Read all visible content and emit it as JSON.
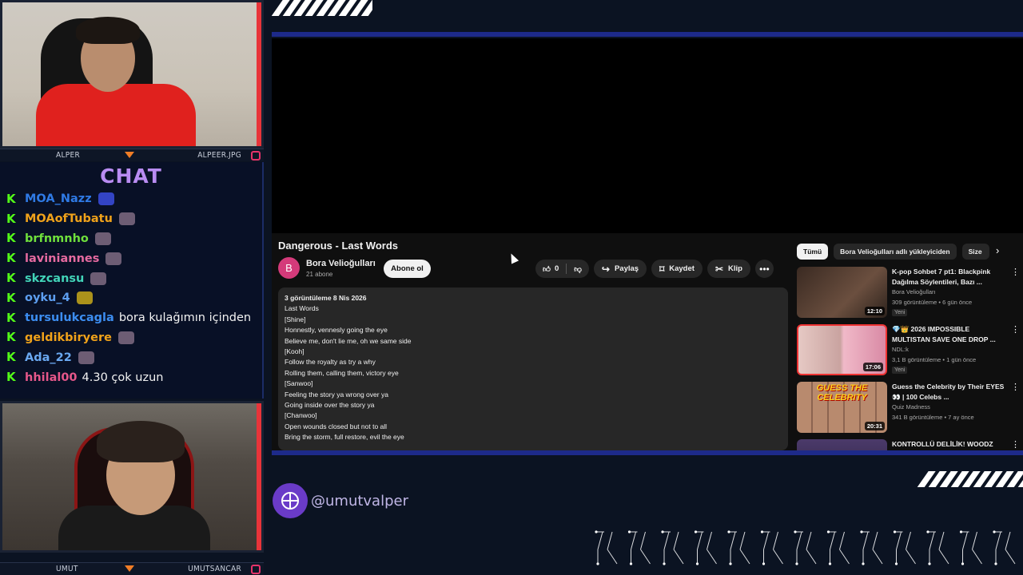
{
  "cams": {
    "top": {
      "left_name": "ALPER",
      "right_name": "ALPEER.JPG"
    },
    "bottom": {
      "left_name": "UMUT",
      "right_name": "UMUTSANCAR"
    }
  },
  "chat": {
    "title": "CHAT",
    "messages": [
      {
        "user": "MOA_Nazz",
        "text": "",
        "color": "#2f7ae5",
        "badge": "blue"
      },
      {
        "user": "MOAofTubatu",
        "text": "",
        "color": "#f0a21a",
        "badge": "emote"
      },
      {
        "user": "brfnmnho",
        "text": "",
        "color": "#6fe03c",
        "badge": "emote"
      },
      {
        "user": "laviniannes",
        "text": "",
        "color": "#e66aa0",
        "badge": "emote"
      },
      {
        "user": "skzcansu",
        "text": "",
        "color": "#42d4b8",
        "badge": "emote"
      },
      {
        "user": "oyku_4",
        "text": "",
        "color": "#5d9ef0",
        "badge": "car"
      },
      {
        "user": "tursulukcagla",
        "text": "bora kulağımın içinden",
        "color": "#3c8df0",
        "badge": ""
      },
      {
        "user": "geldikbiryere",
        "text": "",
        "color": "#f0a21a",
        "badge": "emote"
      },
      {
        "user": "Ada_22",
        "text": "",
        "color": "#6aa8f0",
        "badge": "emote"
      },
      {
        "user": "hhilal00",
        "text": "4.30 çok uzun",
        "color": "#e6578a",
        "badge": ""
      }
    ]
  },
  "youtube": {
    "video_title": "Dangerous - Last Words",
    "channel": {
      "avatar_letter": "B",
      "name": "Bora Velioğulları",
      "subs": "21 abone"
    },
    "subscribe_label": "Abone ol",
    "likes": "0",
    "share_label": "Paylaş",
    "save_label": "Kaydet",
    "clip_label": "Klip",
    "more_label": "•••",
    "description": {
      "stats": "3 görüntüleme  8 Nis 2026",
      "lines": [
        "Last Words",
        "[Shine]",
        "Honnestly, vennesly going the eye",
        "Believe me, don't lie me, oh we same side",
        "[Kooh]",
        "Follow the royalty as try a why",
        "Rolling them, calling them, victory eye",
        "[Sanwoo]",
        "Feeling the story ya wrong over ya",
        "Going inside over the story ya",
        "[Chanwoo]",
        "Open wounds closed but not to all",
        "Bring the storm, full restore, evil the eye"
      ]
    },
    "chips": [
      "Tümü",
      "Bora Velioğulları adlı yükleyiciden",
      "Size"
    ],
    "recommendations": [
      {
        "title": "K-pop Sohbet 7 pt1: Blackpink Dağılma Söylentileri, Bazı ...",
        "channel": "Bora Velioğulları",
        "meta": "309 görüntüleme • 6 gün önce",
        "badge": "Yeni",
        "duration": "12:10"
      },
      {
        "title": "💎👑 2026 IMPOSSIBLE MULTISTAN SAVE ONE DROP ...",
        "channel": "NDL:k",
        "meta": "3,1 B görüntüleme • 1 gün önce",
        "badge": "Yeni",
        "duration": "17:06"
      },
      {
        "title": "Guess the Celebrity by Their EYES 👀 | 100 Celebs ...",
        "channel": "Quiz Madness",
        "meta": "341 B görüntüleme • 7 ay önce",
        "badge": "",
        "duration": "20:31",
        "thumb_text": "GUESS THE CELEBRITY"
      },
      {
        "title": "KONTROLLÜ DELİLİK! WOODZ",
        "channel": "",
        "meta": "",
        "badge": "",
        "duration": ""
      }
    ]
  },
  "social": {
    "handle": "@umutvalper"
  },
  "colors": {
    "accent_line": "#1d2a8a",
    "kick_green": "#53fc18",
    "chat_title": "#b98cf2"
  }
}
